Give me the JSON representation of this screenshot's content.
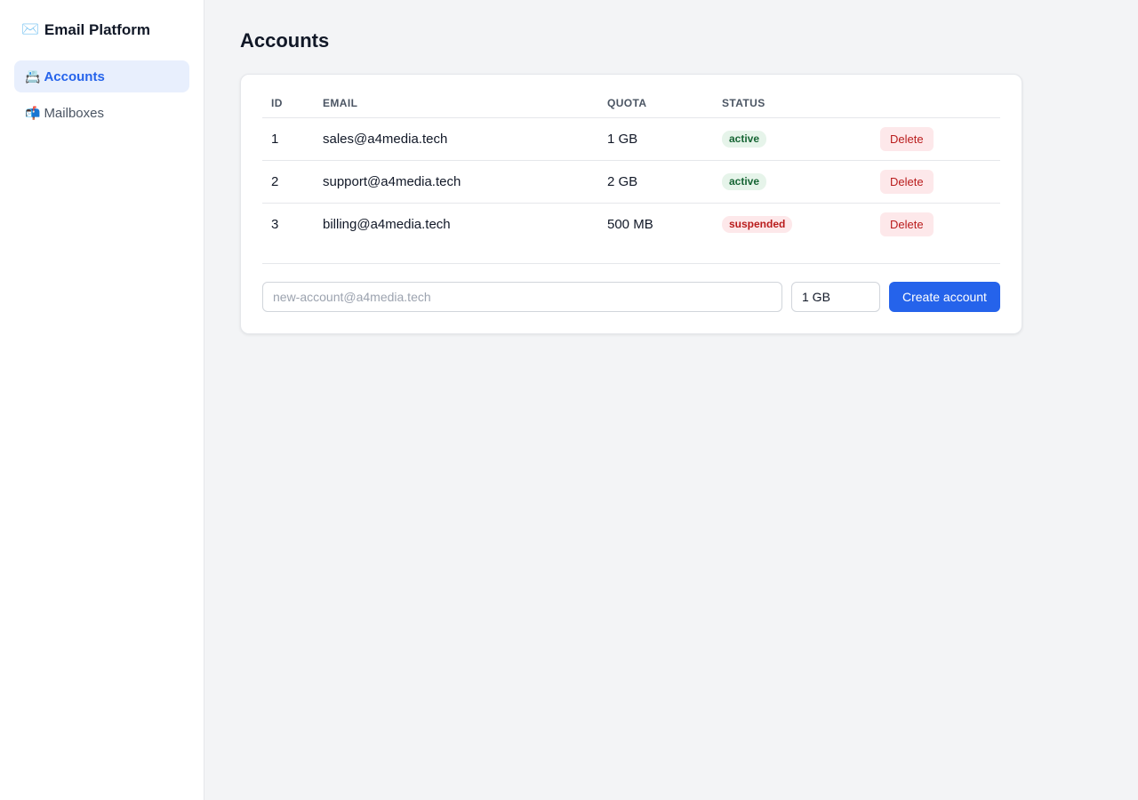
{
  "brand": {
    "icon": "✉️",
    "title": "Email Platform"
  },
  "sidebar": {
    "items": [
      {
        "icon": "📇",
        "label": "Accounts",
        "active": true
      },
      {
        "icon": "📬",
        "label": "Mailboxes",
        "active": false
      }
    ]
  },
  "main": {
    "title": "Accounts"
  },
  "table": {
    "headers": {
      "id": "ID",
      "email": "EMAIL",
      "quota": "QUOTA",
      "status": "STATUS"
    },
    "rows": [
      {
        "id": "1",
        "email": "sales@a4media.tech",
        "quota": "1 GB",
        "status": "active",
        "action": "Delete"
      },
      {
        "id": "2",
        "email": "support@a4media.tech",
        "quota": "2 GB",
        "status": "active",
        "action": "Delete"
      },
      {
        "id": "3",
        "email": "billing@a4media.tech",
        "quota": "500 MB",
        "status": "suspended",
        "action": "Delete"
      }
    ]
  },
  "create_form": {
    "email_placeholder": "new-account@a4media.tech",
    "email_value": "",
    "quota_value": "1 GB",
    "submit_label": "Create account"
  },
  "colors": {
    "accent": "#2563eb",
    "active_badge_bg": "#e6f4ea",
    "active_badge_text": "#166534",
    "suspended_badge_bg": "#fde8ea",
    "suspended_badge_text": "#b91c1c"
  }
}
